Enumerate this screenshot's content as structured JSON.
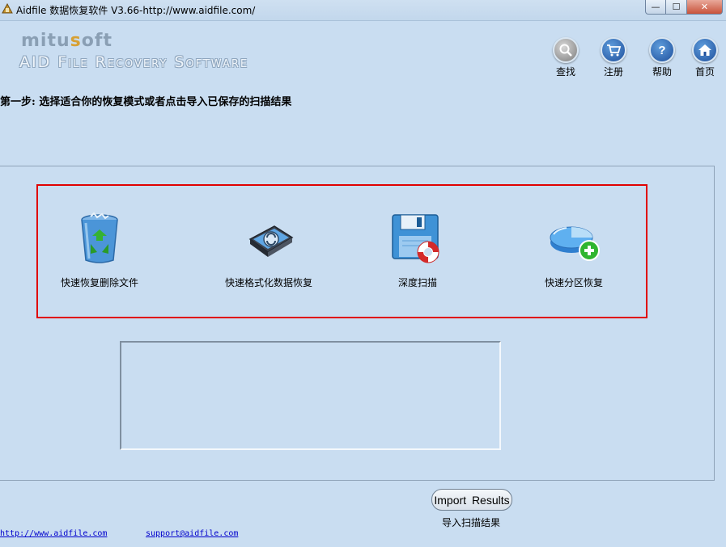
{
  "window": {
    "title": "Aidfile 数据恢复软件 V3.66-http://www.aidfile.com/",
    "min_label": "—",
    "max_label": "☐",
    "close_label": "✕"
  },
  "logo": {
    "brand_start": "mitu",
    "brand_accent": "s",
    "brand_end": "oft",
    "tagline": "AID File Recovery Software"
  },
  "toolbar": [
    {
      "label": "查找",
      "icon": "search-icon"
    },
    {
      "label": "注册",
      "icon": "cart-icon"
    },
    {
      "label": "帮助",
      "icon": "help-icon"
    },
    {
      "label": "首页",
      "icon": "home-icon"
    }
  ],
  "step_title": "第一步: 选择适合你的恢复模式或者点击导入已保存的扫描结果",
  "modes": [
    {
      "label": "快速恢复删除文件",
      "icon": "recycle-bin-icon"
    },
    {
      "label": "快速格式化数据恢复",
      "icon": "format-drive-icon"
    },
    {
      "label": "深度扫描",
      "icon": "floppy-lifebuoy-icon"
    },
    {
      "label": "快速分区恢复",
      "icon": "partition-add-icon"
    }
  ],
  "import": {
    "button_label": "Import Results",
    "caption": "导入扫描结果"
  },
  "footer": {
    "website": "http://www.aidfile.com",
    "email": "support@aidfile.com"
  },
  "colors": {
    "background": "#c9ddf1",
    "highlight_border": "#e00000",
    "link": "#0000cc"
  }
}
